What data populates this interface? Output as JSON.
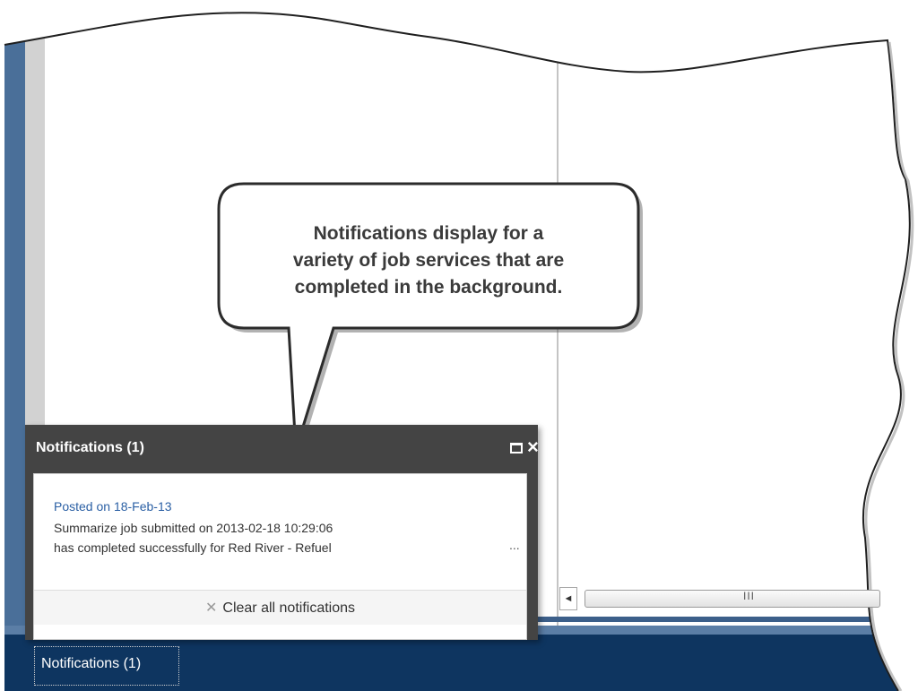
{
  "callout": {
    "lines": [
      "Notifications display for a",
      "variety of job services that are",
      "completed in the background."
    ]
  },
  "notification_panel": {
    "title": "Notifications (1)",
    "header_icons": [
      "maximize-icon",
      "close-icon"
    ],
    "items": [
      {
        "date": "Posted on 18-Feb-13",
        "line1": "Summarize job submitted on 2013-02-18 10:29:06",
        "line2": "has completed successfully for Red River - Refuel",
        "more": "..."
      }
    ],
    "clear_label": "Clear all notifications"
  },
  "taskbar": {
    "notifications_label": "Notifications (1)"
  },
  "scrollbar": {
    "left_arrow": "◄",
    "grip": "III"
  },
  "colors": {
    "sidebar_blue": "#4a6f99",
    "taskbar_navy": "#0e3560",
    "panel_dark": "#444444",
    "link_blue": "#2a5fa4"
  }
}
